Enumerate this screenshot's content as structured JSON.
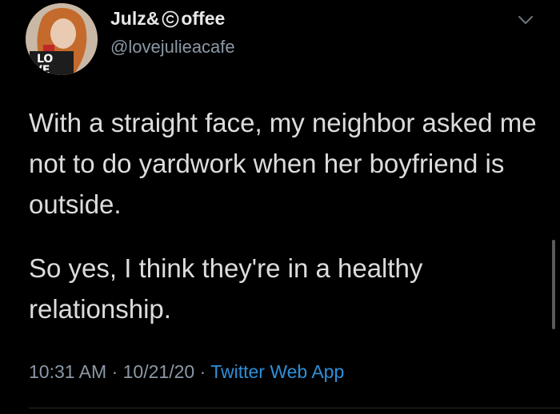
{
  "tweet": {
    "author_name_prefix": "Julz&",
    "author_name_suffix": "offee",
    "author_handle": "@lovejulieacafe",
    "paragraphs": [
      "With a straight face, my neighbor asked me not to do yardwork when her boyfriend is outside.",
      "So yes, I think they're in a healthy relationship."
    ],
    "time": "10:31 AM",
    "date": "10/21/20",
    "separator": "·",
    "source_app": "Twitter Web App"
  },
  "icons": {
    "name_glyph": "copyright-icon",
    "menu": "chevron-down-icon"
  },
  "colors": {
    "background": "#000000",
    "text": "#dcdcdc",
    "secondary": "#8b98a5",
    "link": "#2f8fd8"
  }
}
